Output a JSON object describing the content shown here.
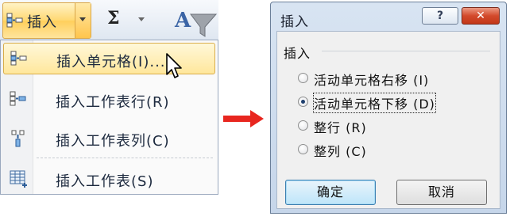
{
  "ribbon": {
    "insert_button_label": "插入",
    "sum_symbol": "Σ"
  },
  "menu": {
    "items": [
      {
        "label": "插入单元格(I)...",
        "icon": "insert-cells-icon"
      },
      {
        "label": "插入工作表行(R)",
        "icon": "insert-row-icon"
      },
      {
        "label": "插入工作表列(C)",
        "icon": "insert-column-icon"
      },
      {
        "label": "插入工作表(S)",
        "icon": "insert-sheet-icon"
      }
    ]
  },
  "dialog": {
    "title": "插入",
    "help_symbol": "?",
    "close_symbol": "✕",
    "group_label": "插入",
    "options": [
      {
        "label": "活动单元格右移 (I)",
        "checked": false
      },
      {
        "label": "活动单元格下移 (D)",
        "checked": true
      },
      {
        "label": "整行 (R)",
        "checked": false
      },
      {
        "label": "整列 (C)",
        "checked": false
      }
    ],
    "ok_label": "确定",
    "cancel_label": "取消"
  },
  "colors": {
    "highlight": "#ffd975",
    "arrow": "#e8261f",
    "dialog_frame": "#c6d6ea",
    "close_button": "#d34a2c"
  }
}
